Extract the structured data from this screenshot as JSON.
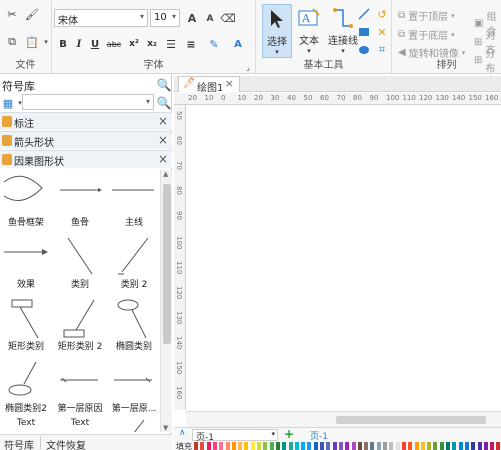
{
  "ribbon": {
    "file_group": {
      "label": "文件"
    },
    "font_group": {
      "label": "字体",
      "font_name": "宋体",
      "font_size": "10",
      "grow_font": "A",
      "shrink_font": "A",
      "bold": "B",
      "italic": "I",
      "underline": "U",
      "strikethrough": "abc",
      "superscript": "x²",
      "subscript": "x₂",
      "font_color": "A"
    },
    "tools_group": {
      "label": "基本工具",
      "select_label": "选择",
      "text_label": "文本",
      "connector_label": "连接线"
    },
    "arrange_group": {
      "label": "排列",
      "bring_front": "置于顶层",
      "send_back": "置于底层",
      "rotate_mirror": "旋转和镜像",
      "group": "组合",
      "align": "对齐",
      "distribute": "分布"
    }
  },
  "library": {
    "title": "符号库",
    "categories": [
      "标注",
      "箭头形状",
      "因果图形状"
    ],
    "shapes": [
      {
        "label": "鱼骨框架",
        "icon": "fish-frame-icon"
      },
      {
        "label": "鱼骨",
        "icon": "fishbone-icon"
      },
      {
        "label": "主线",
        "icon": "main-line-icon"
      },
      {
        "label": "效果",
        "icon": "effect-arrow-icon"
      },
      {
        "label": "类别",
        "icon": "category-line-icon"
      },
      {
        "label": "类别 2",
        "icon": "category2-line-icon"
      },
      {
        "label": "矩形类别",
        "icon": "rect-category-icon"
      },
      {
        "label": "矩形类别 2",
        "icon": "rect-category2-icon"
      },
      {
        "label": "椭圆类别",
        "icon": "ellipse-category-icon"
      },
      {
        "label": "椭圆类别2",
        "icon": "ellipse-category2-icon"
      },
      {
        "label": "第一层原因",
        "icon": "first-cause-icon"
      },
      {
        "label": "第一层原...",
        "icon": "first-cause2-icon"
      },
      {
        "label": "Text",
        "icon": "text-icon"
      },
      {
        "label": "Text",
        "icon": "text2-icon"
      }
    ],
    "tabs": [
      "符号库",
      "文件恢复"
    ]
  },
  "document": {
    "tab_label": "绘图1",
    "h_ruler_ticks": [
      "20",
      "10",
      "0",
      "10",
      "20",
      "30",
      "40",
      "50",
      "60",
      "70",
      "80",
      "90",
      "100",
      "110",
      "120",
      "130",
      "140",
      "150",
      "160",
      "170"
    ],
    "v_ruler_ticks": [
      "50",
      "60",
      "70",
      "80",
      "90",
      "100",
      "110",
      "120",
      "130",
      "140",
      "150",
      "160"
    ],
    "page_selector": "页-1",
    "page_tab": "页-1",
    "fill_label": "填充"
  },
  "colors": {
    "accent": "#2f7fd0",
    "palette": [
      "#c0392b",
      "#e74c3c",
      "#e91e63",
      "#ff4081",
      "#ff6f91",
      "#ff8a65",
      "#ff9800",
      "#ffb74d",
      "#ffc107",
      "#ffeb3b",
      "#cddc39",
      "#8bc34a",
      "#4caf50",
      "#2e7d32",
      "#009688",
      "#26a69a",
      "#00bcd4",
      "#03a9f4",
      "#2196f3",
      "#1565c0",
      "#3f51b5",
      "#5c6bc0",
      "#673ab7",
      "#7e57c2",
      "#9c27b0",
      "#ab47bc",
      "#6d4c41",
      "#8d6e63",
      "#607d8b",
      "#90a4ae",
      "#9e9e9e",
      "#bdbdbd",
      "#e0e0e0",
      "#f44336",
      "#ff5722",
      "#ffa000",
      "#fbc02d",
      "#afb42b",
      "#689f38",
      "#388e3c",
      "#00796b",
      "#0097a7",
      "#0288d1",
      "#1976d2",
      "#303f9f",
      "#512da8",
      "#7b1fa2",
      "#c2185b",
      "#d32f2f"
    ]
  }
}
